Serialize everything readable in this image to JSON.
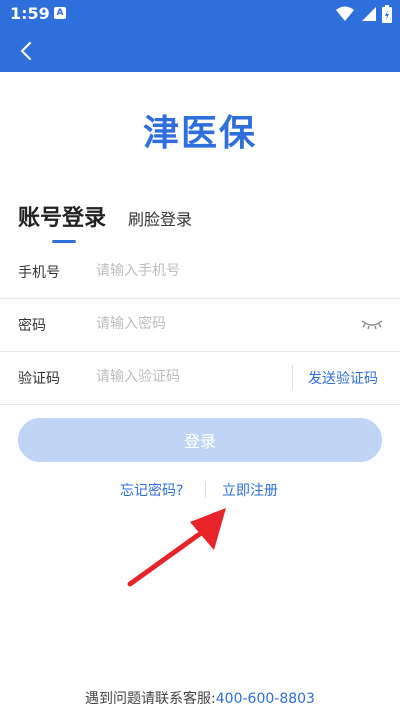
{
  "status_bar": {
    "time": "1:59",
    "notification_glyph": "A"
  },
  "app_bar": {
    "back_icon": "chevron-left-icon"
  },
  "logo": {
    "text": "津医保"
  },
  "tabs": {
    "active": "账号登录",
    "inactive": "刷脸登录"
  },
  "form": {
    "phone": {
      "label": "手机号",
      "placeholder": "请输入手机号"
    },
    "password": {
      "label": "密码",
      "placeholder": "请输入密码"
    },
    "code": {
      "label": "验证码",
      "placeholder": "请输入验证码",
      "send_label": "发送验证码"
    }
  },
  "login_button": "登录",
  "links": {
    "forgot": "忘记密码?",
    "register": "立即注册"
  },
  "footer": {
    "text": "遇到问题请联系客服:",
    "phone": "400-600-8803"
  },
  "colors": {
    "brand": "#2f6fdc",
    "button_disabled": "#c0d4f6",
    "annotation": "#e8242a"
  }
}
